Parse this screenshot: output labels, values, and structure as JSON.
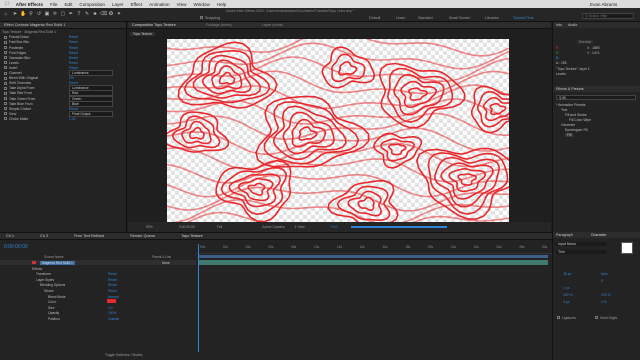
{
  "menubar": {
    "apple": "",
    "app": "After Effects",
    "items": [
      "File",
      "Edit",
      "Composition",
      "Layer",
      "Effect",
      "Animation",
      "View",
      "Window",
      "Help"
    ],
    "title": "Adobe After Effects 2020 - /Users/evanabrams/Documents/Tutorials/Topo Lines.aep *",
    "user": "Evan Abrams"
  },
  "toolbar": {
    "snapping": "Snapping",
    "workspaces": [
      "Default",
      "Learn",
      "Standard",
      "Small Screen",
      "Libraries",
      "Tutorial Time"
    ],
    "active_workspace": "Tutorial Time",
    "search_placeholder": "Search Help"
  },
  "effect_controls": {
    "tab": "Effect Controls Magenta Red Solid 1",
    "breadcrumb": "Topo Texture · Magenta Red Solid 1",
    "rows": [
      {
        "label": "Fractal Noise",
        "value": "Reset"
      },
      {
        "label": "Fast Box Blur",
        "value": "Reset"
      },
      {
        "label": "Posterize",
        "value": "Reset"
      },
      {
        "label": "Find Edges",
        "value": "Reset"
      },
      {
        "label": "Gaussian Blur",
        "value": "Reset"
      },
      {
        "label": "Levels",
        "value": "Reset"
      },
      {
        "label": "Invert",
        "value": "Reset"
      },
      {
        "label": "Channel",
        "value": "Luminance"
      },
      {
        "label": "Blend With Original",
        "value": "0%"
      },
      {
        "label": "Shift Channels",
        "value": "Reset"
      },
      {
        "label": "Take Alpha From",
        "value": "Luminance"
      },
      {
        "label": "Take Red From",
        "value": "Red"
      },
      {
        "label": "Take Green From",
        "value": "Green"
      },
      {
        "label": "Take Blue From",
        "value": "Blue"
      },
      {
        "label": "Simple Choker",
        "value": "Reset"
      },
      {
        "label": "View",
        "value": "Final Output"
      },
      {
        "label": "Choke Matte",
        "value": "1.00"
      }
    ]
  },
  "composition": {
    "tabs": [
      "Composition Topo Texture",
      "Footage (none)",
      "Layer (none)"
    ],
    "view_tab": "Topo Texture",
    "zoom": "50%",
    "timecode": "0:00:00:00",
    "resolution": "Full",
    "camera": "Active Camera",
    "views": "1 View",
    "exposure": "+0.0",
    "line_color": "#e8282c"
  },
  "info_panel": {
    "tabs": [
      "Info",
      "Audio"
    ],
    "r": "R :",
    "g": "G :",
    "b": "B :",
    "a": "A : 255",
    "x": "X : 1880",
    "y": "Y : 1474",
    "layer": "\"Topo Texture\", layer 1",
    "sub": "Levels"
  },
  "preview_panel": {
    "tab": "Preview"
  },
  "effects_presets": {
    "title": "Effects & Presets",
    "search": "fill",
    "items": [
      "* Animation Presets",
      "Text",
      "Fill and Stroke",
      "Fill Color Wipe",
      "Generate",
      "Eyedropper Fill",
      "Fill"
    ]
  },
  "timeline": {
    "tabs": [
      "Ch 1",
      "Ch 2",
      "Flow Text Refined",
      "Render Queue",
      "Topo Texture"
    ],
    "timecode": "0:00:00:00",
    "col_source": "Source Name",
    "col_parent": "Parent & Link",
    "layer_name": "Magenta Red Solid 1",
    "layer_parent": "None",
    "props": [
      {
        "name": "Effects",
        "value": ""
      },
      {
        "name": "Transform",
        "value": "Reset"
      },
      {
        "name": "Layer Styles",
        "value": "Reset"
      },
      {
        "name": "Blending Options",
        "value": "Reset"
      },
      {
        "name": "Stroke",
        "value": "Reset"
      },
      {
        "name": "Blend Mode",
        "value": "Normal"
      },
      {
        "name": "Color",
        "value": ""
      },
      {
        "name": "Size",
        "value": "3.0"
      },
      {
        "name": "Opacity",
        "value": "100%"
      },
      {
        "name": "Position",
        "value": "Outside"
      }
    ],
    "ruler": [
      "00s",
      "02s",
      "04s",
      "06s",
      "08s",
      "10s",
      "12s",
      "14s",
      "16s",
      "18s",
      "20s",
      "22s",
      "24s",
      "26s",
      "28s",
      "30s"
    ],
    "footer": "Toggle Switches / Modes"
  },
  "character": {
    "tabs": [
      "Paragraph",
      "Character"
    ],
    "font": "Input Mono",
    "style": "Thin",
    "size": "38 px",
    "leading": "Auto",
    "tracking": "0",
    "stroke": "1 px",
    "scale_v": "100 %",
    "scale_h": "100 %",
    "baseline": "0 px",
    "tsume": "0 %",
    "ligatures": "Ligatures",
    "hindi": "Hindi Digits"
  }
}
